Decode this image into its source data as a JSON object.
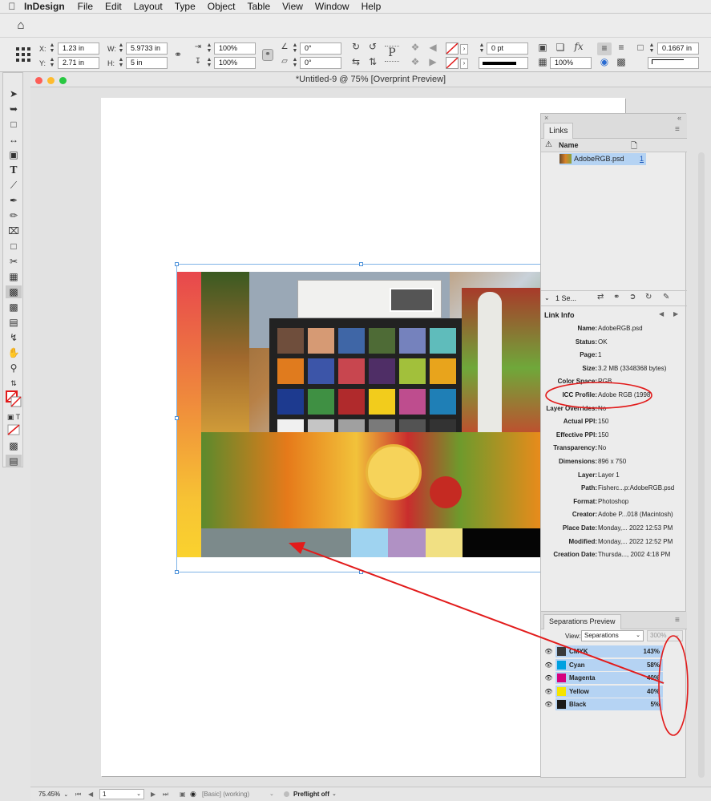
{
  "menubar": {
    "app": "InDesign",
    "items": [
      "File",
      "Edit",
      "Layout",
      "Type",
      "Object",
      "Table",
      "View",
      "Window",
      "Help"
    ]
  },
  "control": {
    "x_label": "X:",
    "x": "1.23 in",
    "y_label": "Y:",
    "y": "2.71 in",
    "w_label": "W:",
    "w": "5.9733 in",
    "h_label": "H:",
    "h": "5 in",
    "scale_x": "100%",
    "scale_y": "100%",
    "rotate": "0°",
    "shear": "0°",
    "stroke_weight": "0 pt",
    "opacity": "100%",
    "offset": "0.1667 in"
  },
  "document": {
    "title": "*Untitled-9 @ 75% [Overprint Preview]"
  },
  "links_panel": {
    "tab": "Links",
    "col_name": "Name",
    "file": "AdobeRGB.psd",
    "page_num": "1",
    "selected_count": "1 Se...",
    "info_title": "Link Info",
    "info": [
      {
        "k": "Name:",
        "v": "AdobeRGB.psd"
      },
      {
        "k": "Status:",
        "v": "OK"
      },
      {
        "k": "Page:",
        "v": "1"
      },
      {
        "k": "Size:",
        "v": "3.2 MB (3348368 bytes)"
      },
      {
        "k": "Color Space:",
        "v": "RGB"
      },
      {
        "k": "ICC Profile:",
        "v": "Adobe RGB (1998)"
      },
      {
        "k": "Layer Overrides:",
        "v": "No"
      },
      {
        "k": "Actual PPI:",
        "v": "150"
      },
      {
        "k": "Effective PPI:",
        "v": "150"
      },
      {
        "k": "Transparency:",
        "v": "No"
      },
      {
        "k": "Dimensions:",
        "v": "896 x 750"
      },
      {
        "k": "Layer:",
        "v": "Layer 1"
      },
      {
        "k": "Path:",
        "v": "Fisherc...p:AdobeRGB.psd"
      },
      {
        "k": "Format:",
        "v": "Photoshop"
      },
      {
        "k": "Creator:",
        "v": "Adobe P...018 (Macintosh)"
      },
      {
        "k": "Place Date:",
        "v": "Monday,... 2022 12:53 PM"
      },
      {
        "k": "Modified:",
        "v": "Monday,... 2022 12:52 PM"
      },
      {
        "k": "Creation Date:",
        "v": "Thursda..., 2002 4:18 PM"
      }
    ]
  },
  "separations": {
    "tab": "Separations Preview",
    "view_label": "View:",
    "view_value": "Separations",
    "zoom": "300%",
    "rows": [
      {
        "name": "CMYK",
        "pct": "143%",
        "color": "#3a3a3a"
      },
      {
        "name": "Cyan",
        "pct": "58%",
        "color": "#00a0e0"
      },
      {
        "name": "Magenta",
        "pct": "40%",
        "color": "#d6007e"
      },
      {
        "name": "Yellow",
        "pct": "40%",
        "color": "#f5e400"
      },
      {
        "name": "Black",
        "pct": "5%",
        "color": "#1a1a1a"
      }
    ]
  },
  "statusbar": {
    "zoom": "75.45%",
    "page": "1",
    "style": "[Basic] (working)",
    "preflight": "Preflight off"
  },
  "annotation_color": "#e21b1b"
}
